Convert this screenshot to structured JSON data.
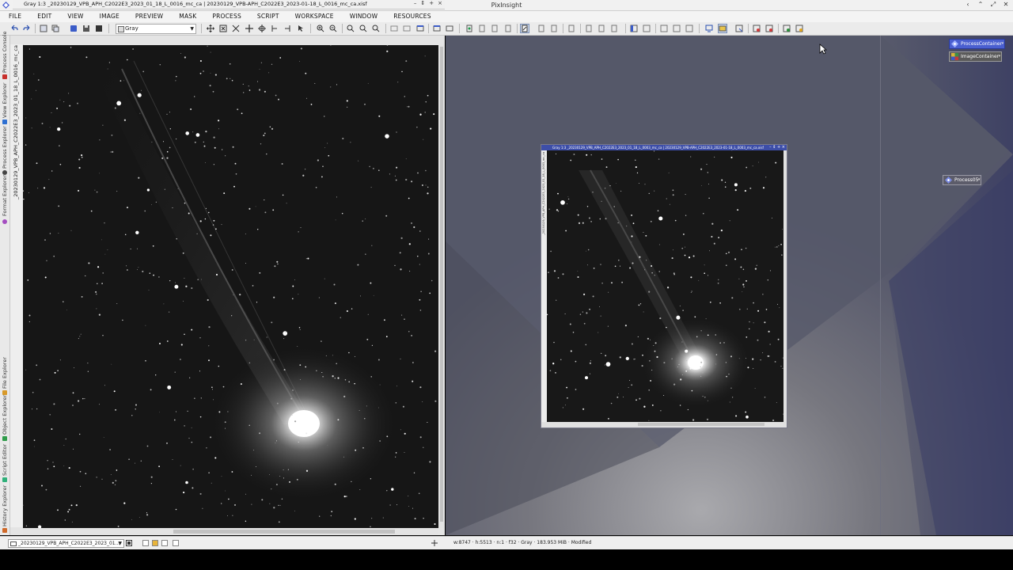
{
  "app": {
    "title": "PixInsight",
    "window_controls": [
      "‹",
      "⌃",
      "⤢",
      "✕"
    ]
  },
  "menu": [
    "FILE",
    "EDIT",
    "VIEW",
    "IMAGE",
    "PREVIEW",
    "MASK",
    "PROCESS",
    "SCRIPT",
    "WORKSPACE",
    "WINDOW",
    "RESOURCES"
  ],
  "toolbar": {
    "channel_combo": "Gray"
  },
  "left_sidebar": {
    "tabs": [
      "Process Console",
      "View Explorer",
      "Process Explorer",
      "Format Explorer",
      "File Explorer",
      "Object Explorer",
      "Script Editor",
      "History Explorer"
    ]
  },
  "image_window_1": {
    "title": "Gray 1:3 _20230129_VPB_APH_C2022E3_2023_01_18_L_0016_mc_ca | 20230129_VPB-APH_C2022E3_2023-01-18_L_0016_mc_ca.xisf",
    "vertical_tab": "_20230129_VPB_APH_C2022E3_2023_01_18_L_0016_mc_ca",
    "controls": [
      "–",
      "⇕",
      "+",
      "×"
    ]
  },
  "image_window_2": {
    "title": "Gray 1:3 _20230129_VPB_APH_C2022E3_2023_01_18_L_0003_mc_ca | 20230129_VPB-APH_C2022E3_2023-01-18_L_0003_mc_ca.xisf",
    "vertical_tab": "_20230129_VPB_APH_C2022E3_2023_01_18_L_0003_mc_ca",
    "controls": "– ⇕ + ×"
  },
  "workspace_icons": {
    "process_container": "ProcessContainer",
    "image_container": "ImageContainer",
    "process05": "Process05"
  },
  "statusbar": {
    "view_combo": "_20230129_VPB_APH_C2022E3_2023_01...",
    "info": "w:8747  ·  h:5513  ·  n:1  ·  f32  ·  Gray  ·  183.953 MiB  ·  Modified"
  },
  "colors": {
    "accent_blue": "#4a5fd0",
    "active_window_title": "#3d4ea8",
    "workspace_bg": "#585a66"
  }
}
